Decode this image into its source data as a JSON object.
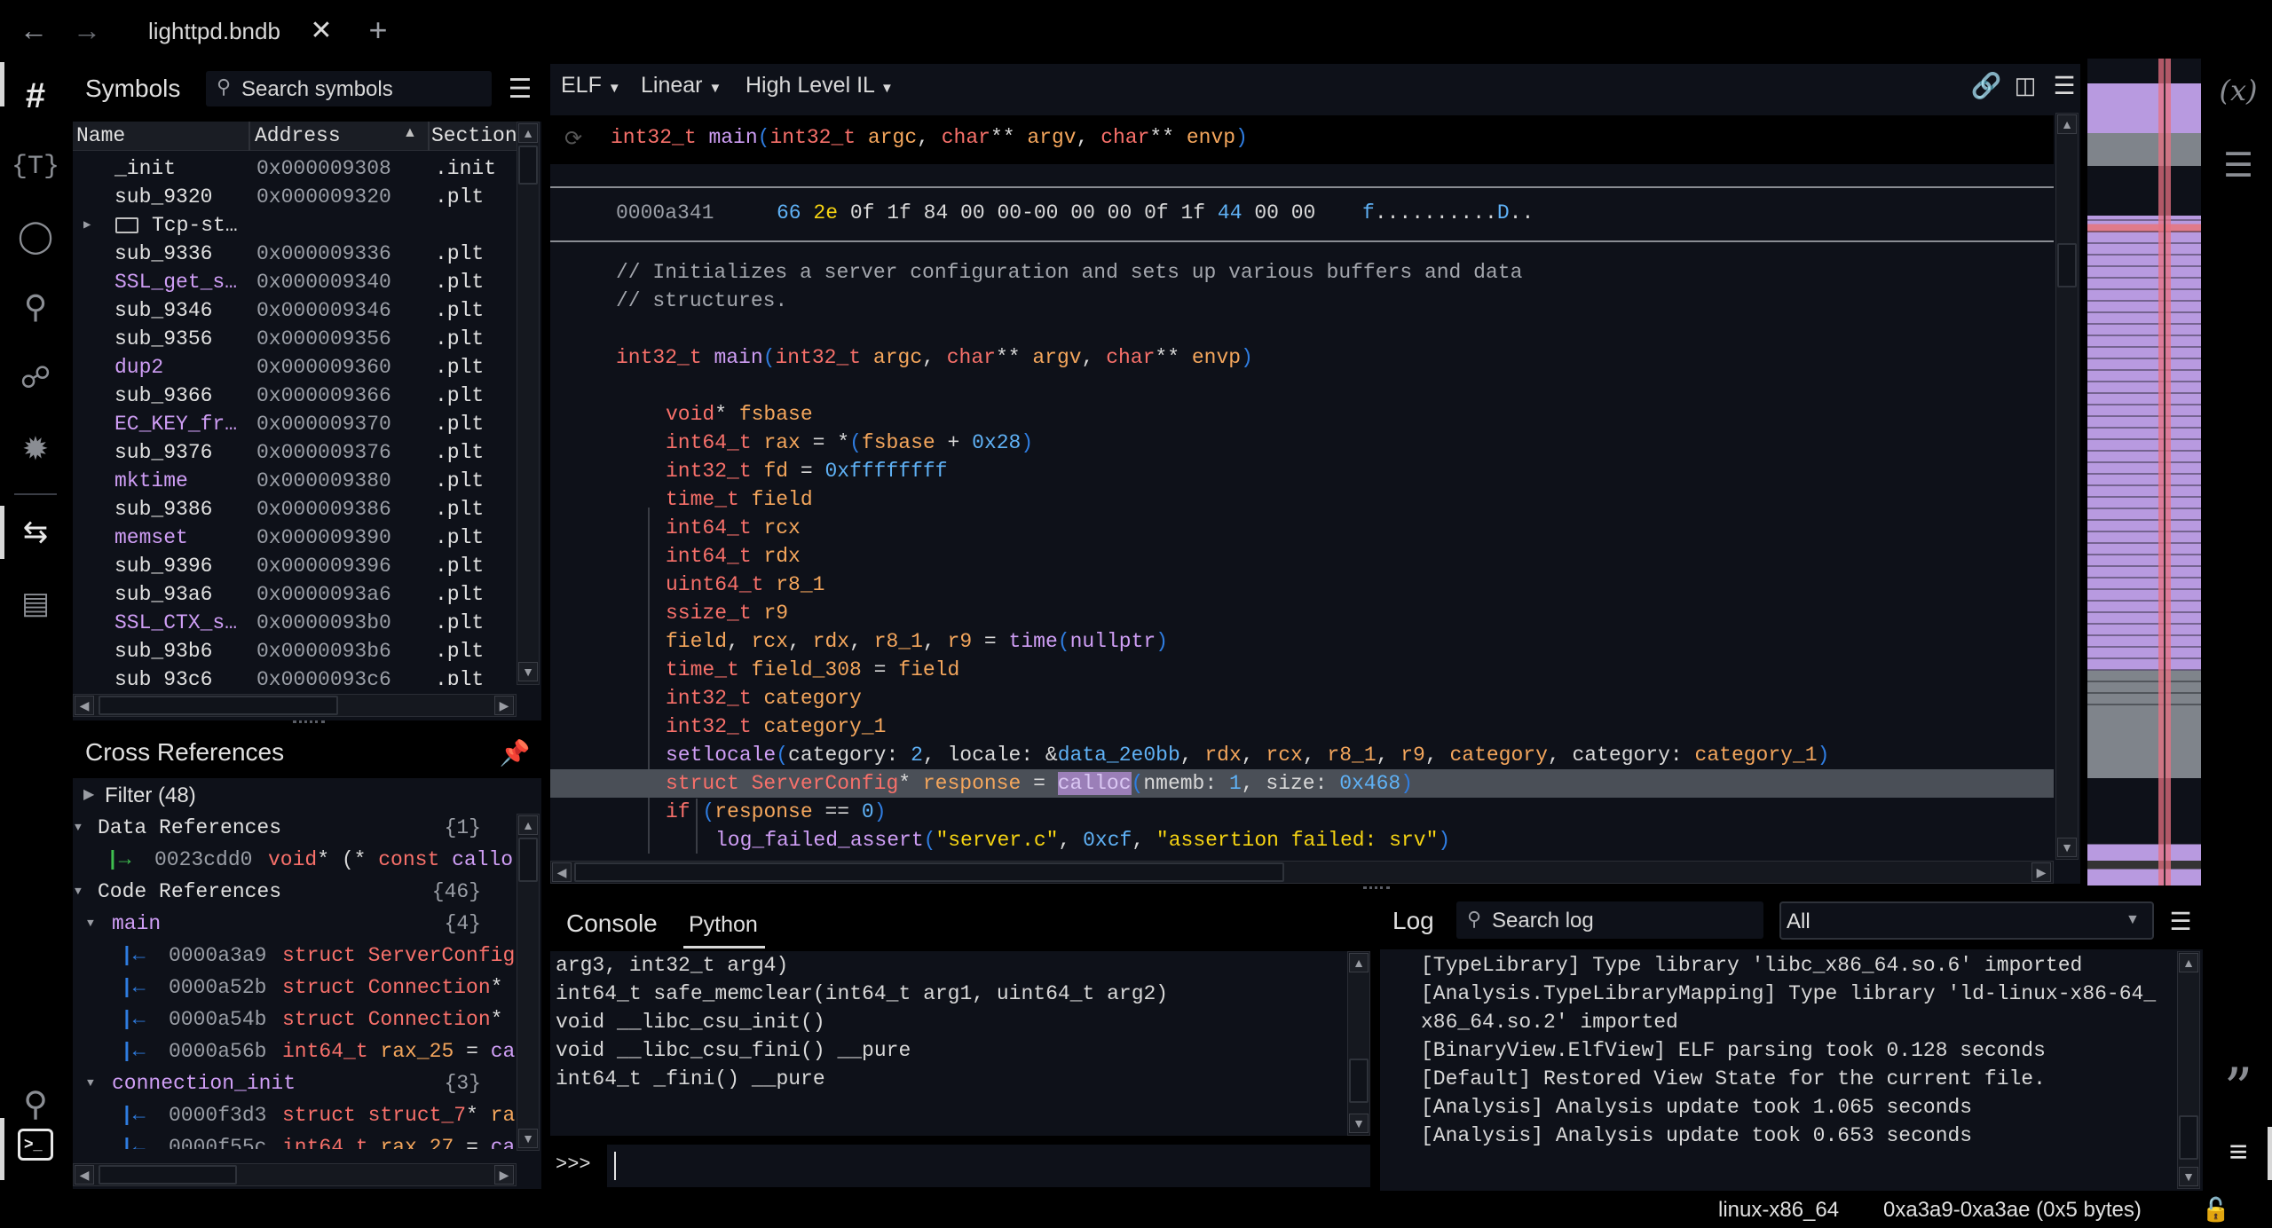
{
  "tabbar": {
    "title": "lighttpd.bndb",
    "back_icon": "arrow-left-icon",
    "forward_icon": "arrow-right-icon",
    "close_icon": "close-icon",
    "new_tab_icon": "plus-icon"
  },
  "left_rail": {
    "icons": [
      "symbols-hash-icon",
      "types-icon",
      "tags-icon",
      "location-icon",
      "graph-icon",
      "debugger-bug-icon",
      "cross-references-icon",
      "hierarchy-icon",
      "search-icon",
      "terminal-icon"
    ]
  },
  "symbols": {
    "title": "Symbols",
    "search_placeholder": "Search symbols",
    "columns": [
      "Name",
      "Address",
      "Section"
    ],
    "rows": [
      {
        "name": "_init",
        "address": "0x000009308",
        "section": ".init",
        "import": false
      },
      {
        "name": "sub_9320",
        "address": "0x000009320",
        "section": ".plt",
        "import": false
      },
      {
        "name": "Tcp-st…",
        "address": "",
        "section": "",
        "folder": true
      },
      {
        "name": "sub_9336",
        "address": "0x000009336",
        "section": ".plt",
        "import": false
      },
      {
        "name": "SSL_get_s…",
        "address": "0x000009340",
        "section": ".plt",
        "import": true
      },
      {
        "name": "sub_9346",
        "address": "0x000009346",
        "section": ".plt",
        "import": false
      },
      {
        "name": "sub_9356",
        "address": "0x000009356",
        "section": ".plt",
        "import": false
      },
      {
        "name": "dup2",
        "address": "0x000009360",
        "section": ".plt",
        "import": true
      },
      {
        "name": "sub_9366",
        "address": "0x000009366",
        "section": ".plt",
        "import": false
      },
      {
        "name": "EC_KEY_fr…",
        "address": "0x000009370",
        "section": ".plt",
        "import": true
      },
      {
        "name": "sub_9376",
        "address": "0x000009376",
        "section": ".plt",
        "import": false
      },
      {
        "name": "mktime",
        "address": "0x000009380",
        "section": ".plt",
        "import": true
      },
      {
        "name": "sub_9386",
        "address": "0x000009386",
        "section": ".plt",
        "import": false
      },
      {
        "name": "memset",
        "address": "0x000009390",
        "section": ".plt",
        "import": true
      },
      {
        "name": "sub_9396",
        "address": "0x000009396",
        "section": ".plt",
        "import": false
      },
      {
        "name": "sub_93a6",
        "address": "0x0000093a6",
        "section": ".plt",
        "import": false
      },
      {
        "name": "SSL_CTX_s…",
        "address": "0x0000093b0",
        "section": ".plt",
        "import": true
      },
      {
        "name": "sub_93b6",
        "address": "0x0000093b6",
        "section": ".plt",
        "import": false
      },
      {
        "name": "sub_93c6",
        "address": "0x0000093c6",
        "section": ".plt",
        "import": false
      }
    ]
  },
  "xrefs": {
    "title": "Cross References",
    "filter": "Filter (48)",
    "rows": [
      {
        "kind": "group",
        "level": 0,
        "label": "Data References",
        "count": "{1}"
      },
      {
        "kind": "item",
        "dir": "to",
        "level": 1,
        "addr": "0023cdd0",
        "tokens": [
          [
            "void",
            "ty"
          ],
          [
            "* (* ",
            "pl"
          ],
          [
            "const",
            "ty"
          ],
          [
            " ",
            "pl"
          ],
          [
            "callo",
            "fn"
          ]
        ]
      },
      {
        "kind": "group",
        "level": 0,
        "label": "Code References",
        "count": "{46}"
      },
      {
        "kind": "func",
        "level": 1,
        "label": "main",
        "count": "{4}"
      },
      {
        "kind": "item",
        "dir": "from",
        "level": 2,
        "addr": "0000a3a9",
        "tokens": [
          [
            "struct ServerConfig",
            "ty"
          ]
        ]
      },
      {
        "kind": "item",
        "dir": "from",
        "level": 2,
        "addr": "0000a52b",
        "tokens": [
          [
            "struct Connection",
            "ty"
          ],
          [
            "*",
            "pl"
          ]
        ]
      },
      {
        "kind": "item",
        "dir": "from",
        "level": 2,
        "addr": "0000a54b",
        "tokens": [
          [
            "struct Connection",
            "ty"
          ],
          [
            "*",
            "pl"
          ]
        ]
      },
      {
        "kind": "item",
        "dir": "from",
        "level": 2,
        "addr": "0000a56b",
        "tokens": [
          [
            "int64_t",
            "ty"
          ],
          [
            " ",
            "pl"
          ],
          [
            "rax_25",
            "va"
          ],
          [
            " = ",
            "pl"
          ],
          [
            "ca",
            "fn"
          ]
        ]
      },
      {
        "kind": "func",
        "level": 1,
        "label": "connection_init",
        "count": "{3}"
      },
      {
        "kind": "item",
        "dir": "from",
        "level": 2,
        "addr": "0000f3d3",
        "tokens": [
          [
            "struct struct_7",
            "ty"
          ],
          [
            "* ",
            "pl"
          ],
          [
            "ra",
            "va"
          ]
        ]
      },
      {
        "kind": "item",
        "dir": "from",
        "level": 2,
        "addr": "0000f55c",
        "tokens": [
          [
            "int64_t",
            "ty"
          ],
          [
            " ",
            "pl"
          ],
          [
            "rax_27",
            "va"
          ],
          [
            " = ",
            "pl"
          ],
          [
            "ca",
            "fn"
          ]
        ]
      }
    ]
  },
  "view": {
    "menus": [
      "ELF",
      "Linear",
      "High Level IL"
    ],
    "icons": [
      "link-icon",
      "split-view-icon",
      "menu-icon"
    ],
    "header_tokens": [
      [
        "int32_t",
        "ty"
      ],
      [
        " ",
        "pl"
      ],
      [
        "main",
        "fn"
      ],
      [
        "(",
        "pa"
      ],
      [
        "int32_t",
        "ty"
      ],
      [
        " ",
        "pl"
      ],
      [
        "argc",
        "va"
      ],
      [
        ", ",
        "pl"
      ],
      [
        "char",
        "ty"
      ],
      [
        "** ",
        "pl"
      ],
      [
        "argv",
        "va"
      ],
      [
        ", ",
        "pl"
      ],
      [
        "char",
        "ty"
      ],
      [
        "** ",
        "pl"
      ],
      [
        "envp",
        "va"
      ],
      [
        ")",
        "pa"
      ]
    ],
    "hex": {
      "address": "0000a341",
      "bytes": [
        [
          "66",
          "nu"
        ],
        [
          " ",
          "pl"
        ],
        [
          "2e",
          "st"
        ],
        [
          " 0f 1f 84 00 00-00 00 00 0f 1f ",
          "pl"
        ],
        [
          "44",
          "nu"
        ],
        [
          " 00 00",
          "pl"
        ]
      ],
      "ascii": [
        [
          "f",
          "nu"
        ],
        [
          "..........",
          "pl"
        ],
        [
          "D",
          "nu"
        ],
        [
          "..",
          "pl"
        ]
      ]
    },
    "lines": [
      {
        "indent": 0,
        "tokens": [
          [
            "// Initializes a server configuration and sets up various buffers and data",
            "cm"
          ]
        ]
      },
      {
        "indent": 0,
        "tokens": [
          [
            "// structures.",
            "cm"
          ]
        ]
      },
      {
        "indent": 0,
        "tokens": []
      },
      {
        "indent": 0,
        "tokens": [
          [
            "int32_t",
            "ty"
          ],
          [
            " ",
            "pl"
          ],
          [
            "main",
            "fn"
          ],
          [
            "(",
            "pa"
          ],
          [
            "int32_t",
            "ty"
          ],
          [
            " ",
            "pl"
          ],
          [
            "argc",
            "va"
          ],
          [
            ", ",
            "pl"
          ],
          [
            "char",
            "ty"
          ],
          [
            "** ",
            "pl"
          ],
          [
            "argv",
            "va"
          ],
          [
            ", ",
            "pl"
          ],
          [
            "char",
            "ty"
          ],
          [
            "** ",
            "pl"
          ],
          [
            "envp",
            "va"
          ],
          [
            ")",
            "pa"
          ]
        ]
      },
      {
        "indent": 0,
        "tokens": []
      },
      {
        "indent": 1,
        "tokens": [
          [
            "void",
            "ty"
          ],
          [
            "* ",
            "pl"
          ],
          [
            "fsbase",
            "va"
          ]
        ]
      },
      {
        "indent": 1,
        "tokens": [
          [
            "int64_t",
            "ty"
          ],
          [
            " ",
            "pl"
          ],
          [
            "rax",
            "va"
          ],
          [
            " = *",
            "pl"
          ],
          [
            "(",
            "pa"
          ],
          [
            "fsbase",
            "va"
          ],
          [
            " + ",
            "pl"
          ],
          [
            "0x28",
            "nu"
          ],
          [
            ")",
            "pa"
          ]
        ]
      },
      {
        "indent": 1,
        "tokens": [
          [
            "int32_t",
            "ty"
          ],
          [
            " ",
            "pl"
          ],
          [
            "fd",
            "va"
          ],
          [
            " = ",
            "pl"
          ],
          [
            "0xffffffff",
            "nu"
          ]
        ]
      },
      {
        "indent": 1,
        "tokens": [
          [
            "time_t",
            "ty"
          ],
          [
            " ",
            "pl"
          ],
          [
            "field",
            "va"
          ]
        ]
      },
      {
        "indent": 1,
        "tokens": [
          [
            "int64_t",
            "ty"
          ],
          [
            " ",
            "pl"
          ],
          [
            "rcx",
            "va"
          ]
        ]
      },
      {
        "indent": 1,
        "tokens": [
          [
            "int64_t",
            "ty"
          ],
          [
            " ",
            "pl"
          ],
          [
            "rdx",
            "va"
          ]
        ]
      },
      {
        "indent": 1,
        "tokens": [
          [
            "uint64_t",
            "ty"
          ],
          [
            " ",
            "pl"
          ],
          [
            "r8_1",
            "va"
          ]
        ]
      },
      {
        "indent": 1,
        "tokens": [
          [
            "ssize_t",
            "ty"
          ],
          [
            " ",
            "pl"
          ],
          [
            "r9",
            "va"
          ]
        ]
      },
      {
        "indent": 1,
        "tokens": [
          [
            "field",
            "va"
          ],
          [
            ", ",
            "pl"
          ],
          [
            "rcx",
            "va"
          ],
          [
            ", ",
            "pl"
          ],
          [
            "rdx",
            "va"
          ],
          [
            ", ",
            "pl"
          ],
          [
            "r8_1",
            "va"
          ],
          [
            ", ",
            "pl"
          ],
          [
            "r9",
            "va"
          ],
          [
            " = ",
            "pl"
          ],
          [
            "time",
            "fn"
          ],
          [
            "(",
            "pa"
          ],
          [
            "nullptr",
            "fn"
          ],
          [
            ")",
            "pa"
          ]
        ]
      },
      {
        "indent": 1,
        "tokens": [
          [
            "time_t",
            "ty"
          ],
          [
            " ",
            "pl"
          ],
          [
            "field_308",
            "va"
          ],
          [
            " = ",
            "pl"
          ],
          [
            "field",
            "va"
          ]
        ]
      },
      {
        "indent": 1,
        "tokens": [
          [
            "int32_t",
            "ty"
          ],
          [
            " ",
            "pl"
          ],
          [
            "category",
            "va"
          ]
        ]
      },
      {
        "indent": 1,
        "tokens": [
          [
            "int32_t",
            "ty"
          ],
          [
            " ",
            "pl"
          ],
          [
            "category_1",
            "va"
          ]
        ]
      },
      {
        "indent": 1,
        "tokens": [
          [
            "setlocale",
            "fn"
          ],
          [
            "(",
            "pa"
          ],
          [
            "category: ",
            "pl"
          ],
          [
            "2",
            "nu"
          ],
          [
            ", locale: &",
            "pl"
          ],
          [
            "data_2e0bb",
            "nu"
          ],
          [
            ", ",
            "pl"
          ],
          [
            "rdx",
            "va"
          ],
          [
            ", ",
            "pl"
          ],
          [
            "rcx",
            "va"
          ],
          [
            ", ",
            "pl"
          ],
          [
            "r8_1",
            "va"
          ],
          [
            ", ",
            "pl"
          ],
          [
            "r9",
            "va"
          ],
          [
            ", ",
            "pl"
          ],
          [
            "category",
            "va"
          ],
          [
            ", category: ",
            "pl"
          ],
          [
            "category_1",
            "va"
          ],
          [
            ")",
            "pa"
          ]
        ]
      },
      {
        "indent": 1,
        "highlight": true,
        "tokens": [
          [
            "struct ServerConfig",
            "ty"
          ],
          [
            "* ",
            "pl"
          ],
          [
            "response",
            "va"
          ],
          [
            " = ",
            "pl"
          ],
          [
            "calloc",
            "fn hl"
          ],
          [
            "(",
            "pa"
          ],
          [
            "nmemb: ",
            "pl"
          ],
          [
            "1",
            "nu"
          ],
          [
            ", size: ",
            "pl"
          ],
          [
            "0x468",
            "nu"
          ],
          [
            ")",
            "pa"
          ]
        ]
      },
      {
        "indent": 1,
        "tokens": [
          [
            "if",
            "ty"
          ],
          [
            " ",
            "pl"
          ],
          [
            "(",
            "pa"
          ],
          [
            "response",
            "va"
          ],
          [
            " == ",
            "pl"
          ],
          [
            "0",
            "nu"
          ],
          [
            ")",
            "pa"
          ]
        ]
      },
      {
        "indent": 2,
        "tokens": [
          [
            "log_failed_assert",
            "fn"
          ],
          [
            "(",
            "pa"
          ],
          [
            "\"server.c\"",
            "st"
          ],
          [
            ", ",
            "pl"
          ],
          [
            "0xcf",
            "nu"
          ],
          [
            ", ",
            "pl"
          ],
          [
            "\"assertion failed: srv\"",
            "st"
          ],
          [
            ")",
            "pa"
          ]
        ]
      }
    ]
  },
  "console": {
    "tabs": [
      "Console",
      "Python"
    ],
    "active_tab": "Python",
    "prompt": ">>>",
    "lines": [
      "arg3, int32_t arg4)",
      "int64_t safe_memclear(int64_t arg1, uint64_t arg2)",
      "void __libc_csu_init()",
      "void __libc_csu_fini() __pure",
      "int64_t _fini() __pure"
    ]
  },
  "log": {
    "title": "Log",
    "search_placeholder": "Search log",
    "level": "All",
    "lines": [
      "[TypeLibrary] Type library 'libc_x86_64.so.6' imported",
      "[Analysis.TypeLibraryMapping] Type library 'ld-linux-x86-64_",
      "x86_64.so.2' imported",
      "[BinaryView.ElfView] ELF parsing took 0.128 seconds",
      "[Default] Restored View State for the current file.",
      "[Analysis] Analysis update took 1.065 seconds",
      "[Analysis] Analysis update took 0.653 seconds"
    ]
  },
  "right_rail": {
    "icons": [
      "variables-icon",
      "layers-icon",
      "comments-quote-icon",
      "outline-lines-icon"
    ],
    "variables_label": "(x)"
  },
  "status": {
    "platform": "linux-x86_64",
    "selection": "0xa3a9-0xa3ae (0x5 bytes)",
    "lock_icon": "lock-icon"
  },
  "colors": {
    "type": "#f7706a",
    "function": "#cf9ef5",
    "variable": "#f4a65c",
    "number": "#5fb1f5",
    "string": "#f5d312",
    "comment": "#a3a6ad",
    "panel": "#0e1119",
    "minimap": "#b89ae0",
    "highlight": "#4a4f57"
  }
}
